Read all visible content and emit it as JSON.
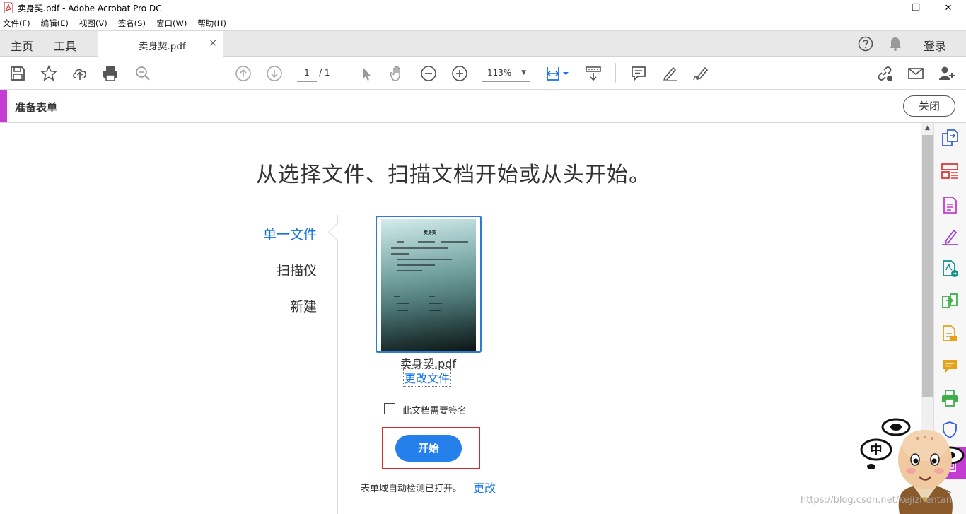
{
  "window": {
    "title": "卖身契.pdf - Adobe Acrobat Pro DC",
    "controls": [
      "—",
      "❐",
      "✕"
    ]
  },
  "menu": [
    "文件(F)",
    "编辑(E)",
    "视图(V)",
    "签名(S)",
    "窗口(W)",
    "帮助(H)"
  ],
  "tabs": {
    "home": "主页",
    "tools": "工具",
    "document": "卖身契.pdf",
    "close": "×",
    "login": "登录"
  },
  "toolbar": {
    "page_current": "1",
    "page_total": "/ 1",
    "zoom": "113%",
    "zoom_caret": "▼"
  },
  "form_header": {
    "title": "准备表单",
    "close_label": "关闭",
    "accent_color": "#c43cd2"
  },
  "main": {
    "headline": "从选择文件、扫描文档开始或从头开始。",
    "options": [
      "单一文件",
      "扫描仪",
      "新建"
    ],
    "active_option": "单一文件",
    "file_name": "卖身契.pdf",
    "change_file": "更改文件",
    "thumbnail_title": "卖身契",
    "signature_label": "此文档需要签名",
    "signature_checked": false,
    "start_label": "开始",
    "autodetect_text": "表单域自动检测已打开。",
    "change_link": "更改",
    "accent_color": "#1473e6",
    "button_color": "#2680eb"
  },
  "watermark": "https://blog.csdn.net/kejizhentan",
  "mascot_text": "中"
}
